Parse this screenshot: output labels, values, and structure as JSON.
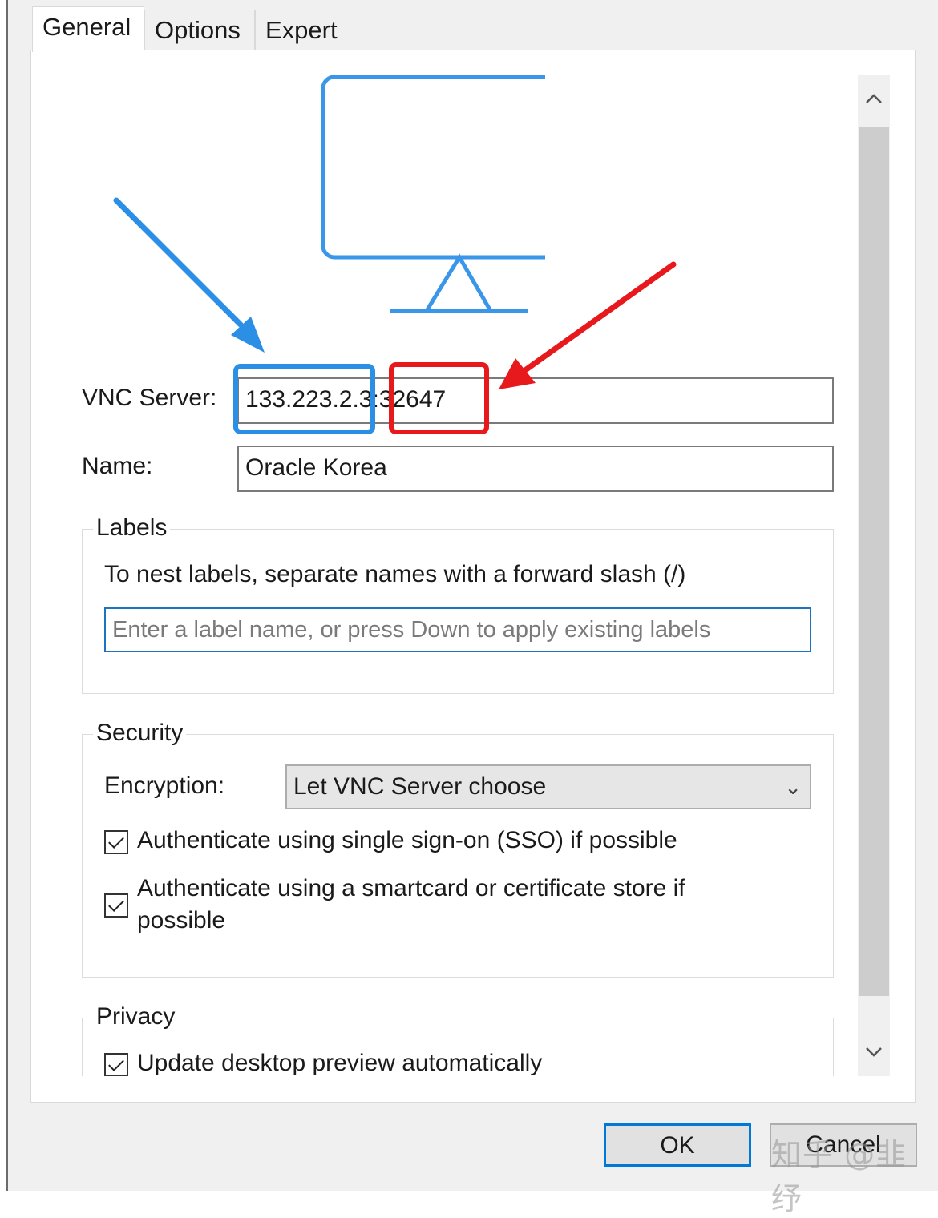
{
  "tabs": [
    {
      "label": "General",
      "active": true
    },
    {
      "label": "Options",
      "active": false
    },
    {
      "label": "Expert",
      "active": false
    }
  ],
  "form": {
    "vnc_server_label": "VNC Server:",
    "vnc_server_value": "133.223.2.3:32647",
    "name_label": "Name:",
    "name_value": "Oracle Korea"
  },
  "labels_group": {
    "title": "Labels",
    "hint": "To nest labels, separate names with a forward slash (/)",
    "input_placeholder": "Enter a label name, or press Down to apply existing labels"
  },
  "security_group": {
    "title": "Security",
    "encryption_label": "Encryption:",
    "encryption_value": "Let VNC Server choose",
    "sso_label": "Authenticate using single sign-on (SSO) if possible",
    "sso_checked": true,
    "smartcard_label_line1": "Authenticate using a smartcard or certificate store if",
    "smartcard_label_line2": "possible",
    "smartcard_checked": true
  },
  "privacy_group": {
    "title": "Privacy",
    "update_preview_label": "Update desktop preview automatically",
    "update_preview_checked": true
  },
  "buttons": {
    "ok": "OK",
    "cancel": "Cancel"
  },
  "watermark": "知乎 @韭纾",
  "icons": {
    "monitor": "monitor-icon",
    "scroll_up": "chevron-up-icon",
    "scroll_down": "chevron-down-icon",
    "dropdown": "chevron-down-icon"
  },
  "colors": {
    "annotation_blue": "#2b8fe6",
    "annotation_red": "#e8191c",
    "monitor_stroke": "#3a96e8",
    "focus_border": "#1e73be"
  }
}
